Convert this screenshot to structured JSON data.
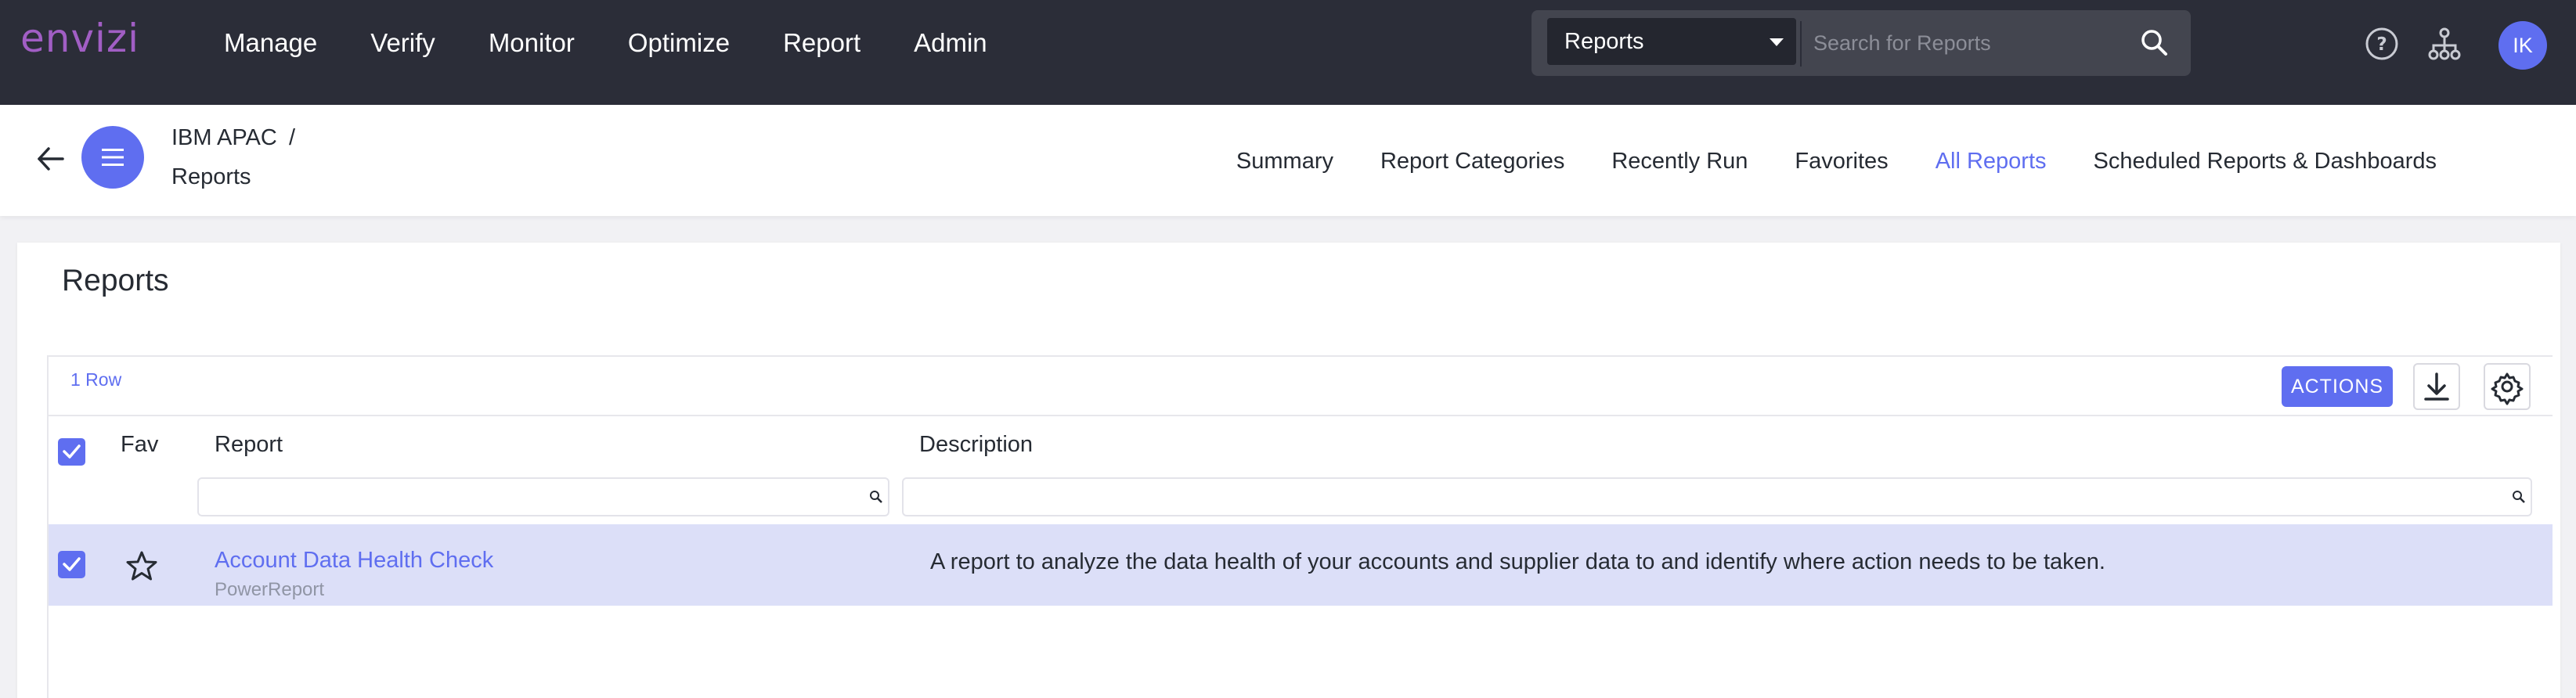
{
  "brand": {
    "logo_text": "envizi",
    "accent": "#5f6ef0",
    "logo_color": "#a15ec4",
    "topbar_bg": "#2b2d38"
  },
  "nav": {
    "items": [
      {
        "label": "Manage"
      },
      {
        "label": "Verify"
      },
      {
        "label": "Monitor"
      },
      {
        "label": "Optimize"
      },
      {
        "label": "Report"
      },
      {
        "label": "Admin"
      }
    ]
  },
  "search": {
    "scope": "Reports",
    "placeholder": "Search for Reports",
    "icon": "search-icon"
  },
  "top_icons": {
    "help": "help-icon",
    "hierarchy": "hierarchy-icon"
  },
  "user": {
    "initials": "IK"
  },
  "breadcrumb": {
    "org": "IBM APAC",
    "separator": "/",
    "page": "Reports"
  },
  "tabs": [
    {
      "label": "Summary",
      "active": false
    },
    {
      "label": "Report Categories",
      "active": false
    },
    {
      "label": "Recently Run",
      "active": false
    },
    {
      "label": "Favorites",
      "active": false
    },
    {
      "label": "All Reports",
      "active": true
    },
    {
      "label": "Scheduled Reports & Dashboards",
      "active": false
    }
  ],
  "panel": {
    "title": "Reports"
  },
  "grid": {
    "row_count": "1 Row",
    "actions_label": "ACTIONS",
    "columns": {
      "fav": "Fav",
      "report": "Report",
      "description": "Description"
    },
    "rows": [
      {
        "selected": true,
        "favorite": false,
        "report": "Account Data Health Check",
        "type": "PowerReport",
        "description": "A report to analyze the data health of your accounts and supplier data to and identify where action needs to be taken."
      }
    ]
  }
}
